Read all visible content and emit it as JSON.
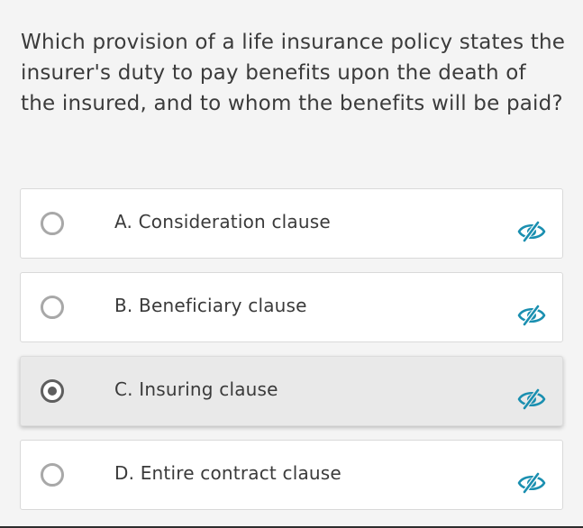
{
  "question": {
    "text": "Which provision of a life insurance policy states the insurer's duty to pay benefits upon the death of the insured, and to whom the benefits will be paid?"
  },
  "options": [
    {
      "label": "A. Consideration clause",
      "selected": false,
      "icon": "eye-slash-icon"
    },
    {
      "label": "B. Beneficiary clause",
      "selected": false,
      "icon": "eye-slash-icon"
    },
    {
      "label": "C. Insuring clause",
      "selected": true,
      "icon": "eye-slash-icon"
    },
    {
      "label": "D. Entire contract clause",
      "selected": false,
      "icon": "eye-slash-icon"
    }
  ],
  "colors": {
    "accent": "#1a8fb0",
    "selected_bg": "#e9e9e9",
    "card_bg": "#ffffff",
    "page_bg": "#f4f4f4"
  }
}
